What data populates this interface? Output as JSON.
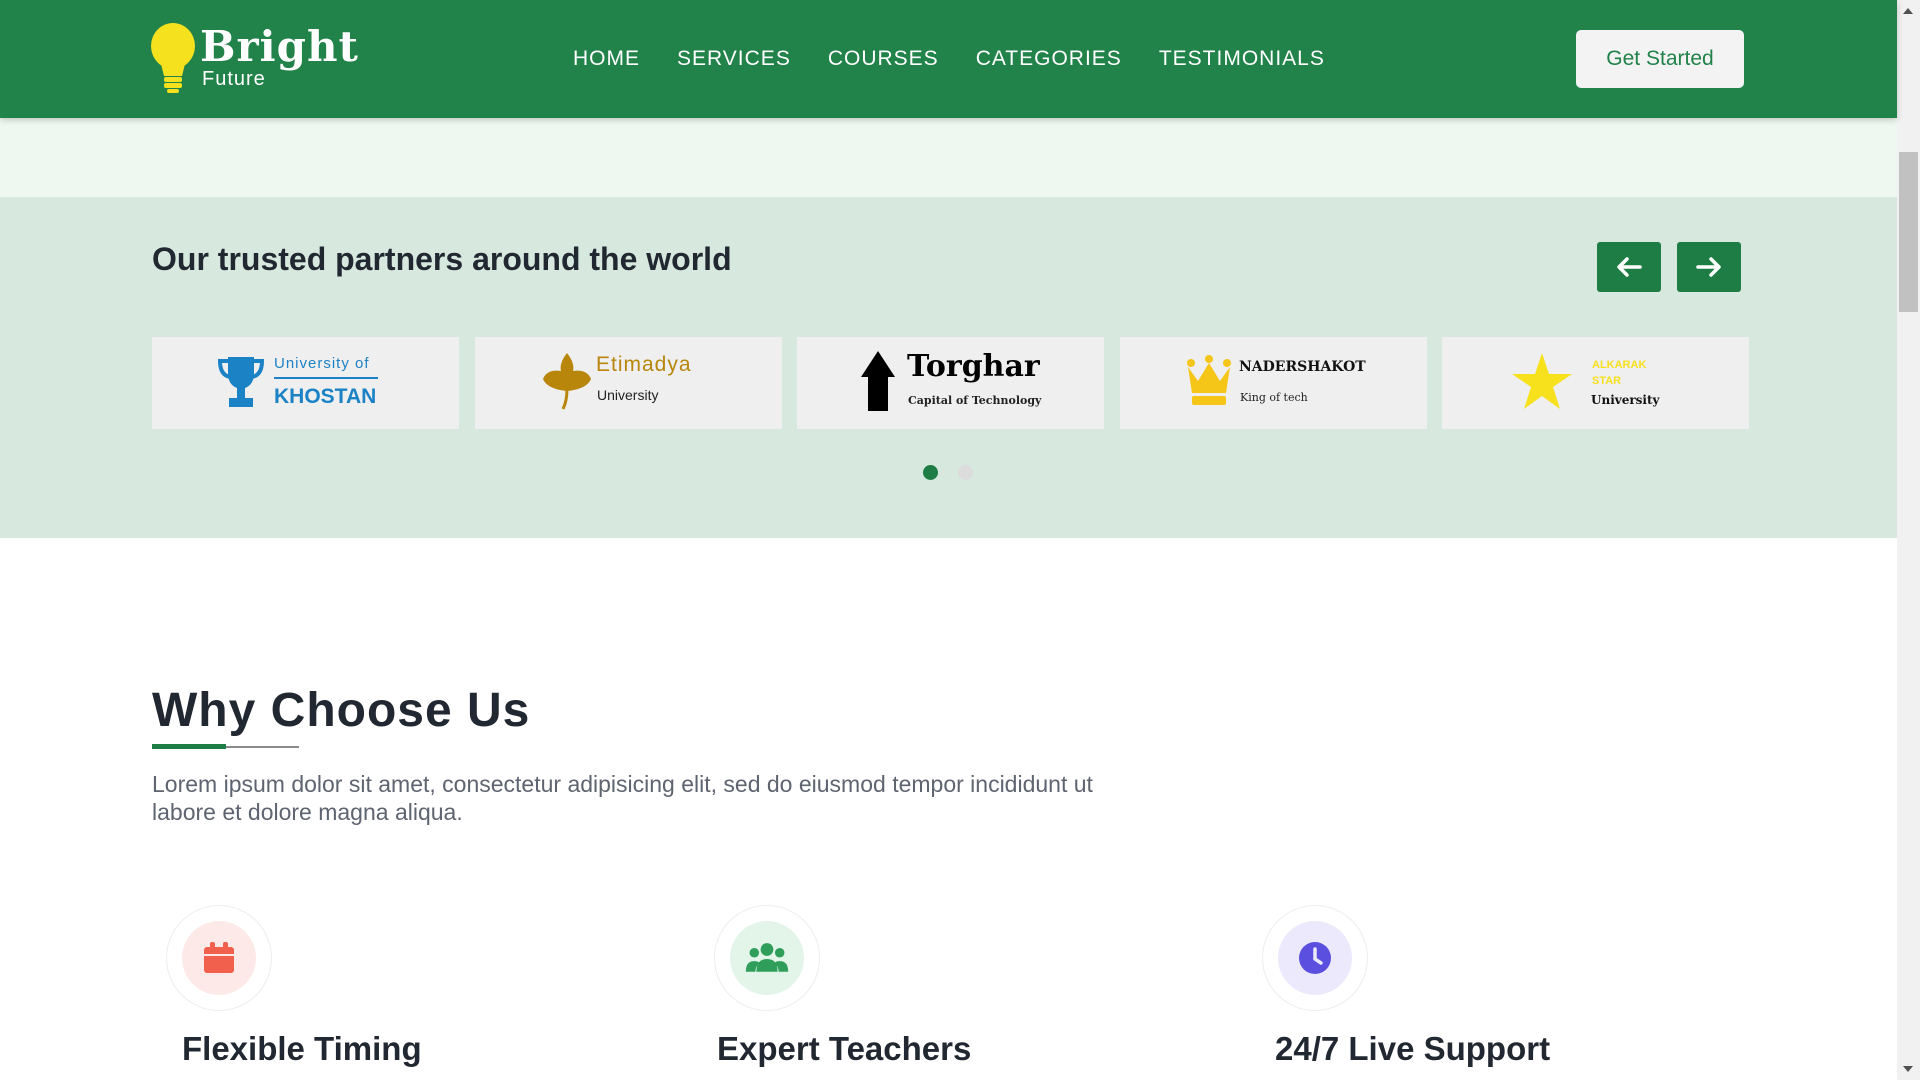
{
  "brand": {
    "name": "Bright",
    "tagline": "Future"
  },
  "nav": {
    "items": [
      "HOME",
      "SERVICES",
      "COURSES",
      "CATEGORIES",
      "TESTIMONIALS"
    ],
    "cta": "Get Started"
  },
  "partners": {
    "title": "Our trusted partners around the world",
    "cards": [
      {
        "line1": "University of",
        "line2": "KHOSTAN",
        "icon": "trophy-icon",
        "color": "#1b82c5"
      },
      {
        "line1": "Etimadya",
        "line2": "University",
        "icon": "leaf-icon",
        "color": "#b8860b"
      },
      {
        "line1": "Torghar",
        "line2": "Capital of Technology",
        "icon": "mountain-arrow-icon",
        "color": "#000000"
      },
      {
        "line1": "NADERSHAKOT",
        "line2": "King of tech",
        "icon": "crown-icon",
        "color": "#f5c518"
      },
      {
        "line1": "ALKARAK STAR",
        "line2": "University",
        "icon": "star-icon",
        "color": "#f7e01c"
      }
    ],
    "carousel": {
      "pages": 2,
      "active_page": 1
    }
  },
  "why": {
    "title": "Why Choose Us",
    "description": "Lorem ipsum dolor sit amet, consectetur adipisicing elit, sed do eiusmod tempor incididunt ut labore et dolore magna aliqua.",
    "features": [
      {
        "title": "Flexible Timing",
        "icon": "calendar-icon",
        "icon_color": "#f0604d",
        "bg_color": "#fde9e7"
      },
      {
        "title": "Expert Teachers",
        "icon": "users-icon",
        "icon_color": "#2f9e5a",
        "bg_color": "#e3f4e9"
      },
      {
        "title": "24/7 Live Support",
        "icon": "clock-icon",
        "icon_color": "#5b4fe0",
        "bg_color": "#ebe9fb"
      }
    ]
  },
  "colors": {
    "primary": "#21824a",
    "hero": "#eef8f1",
    "partners_bg": "#d7e9df",
    "text": "#222831"
  }
}
